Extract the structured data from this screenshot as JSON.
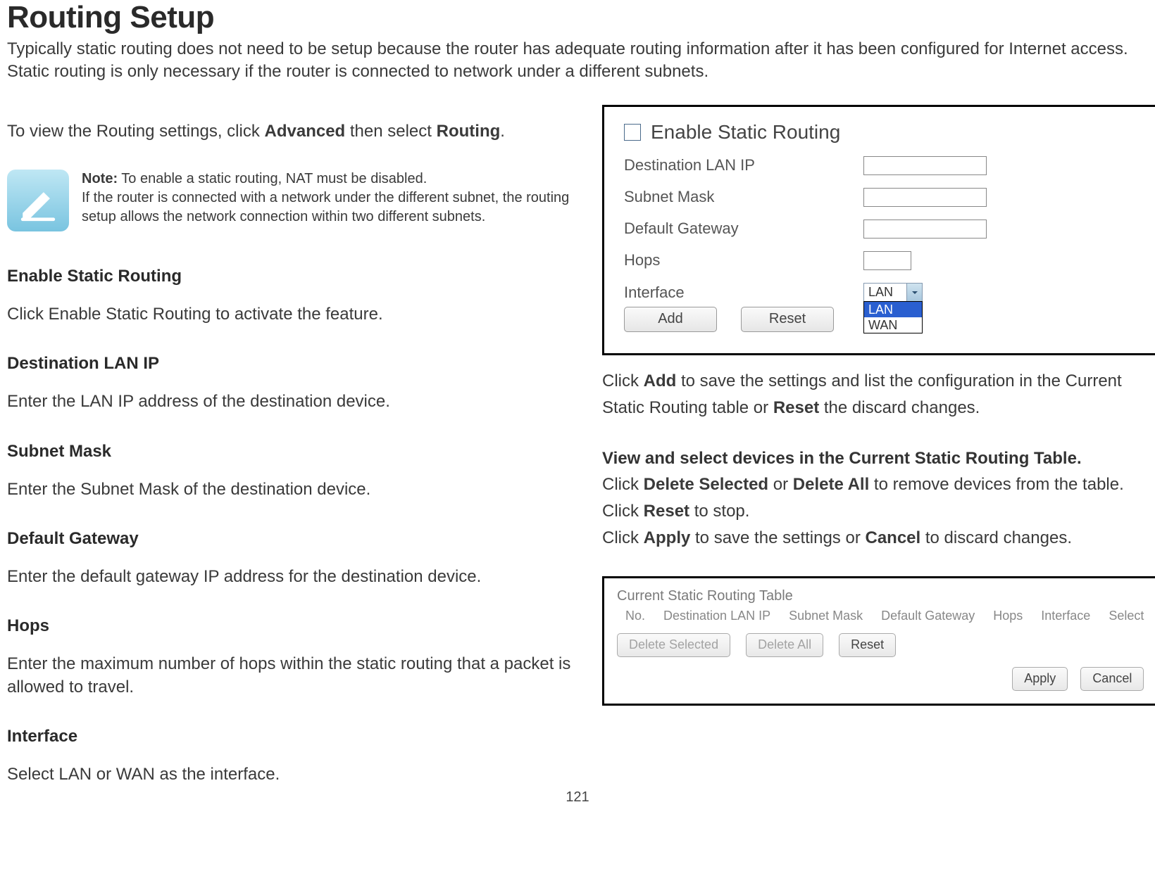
{
  "title": "Routing Setup",
  "intro": "Typically static routing does not need to be setup because the router has adequate routing information after it has been configured for Internet access. Static routing is only necessary if the router is connected to network under a different subnets.",
  "view_line_pre": "To view the Routing settings, click ",
  "view_line_b1": "Advanced",
  "view_line_mid": " then select ",
  "view_line_b2": "Routing",
  "view_line_post": ".",
  "note_label": "Note:",
  "note_line1": " To enable a static routing, NAT must be disabled.",
  "note_line2": "If the router is connected with a network under the different subnet, the routing setup allows the network connection within two different subnets.",
  "sections": {
    "enable": {
      "head": "Enable Static Routing",
      "body": "Click Enable Static Routing to activate the feature."
    },
    "dest": {
      "head": "Destination LAN IP",
      "body": "Enter the LAN IP address of the destination device."
    },
    "mask": {
      "head": "Subnet Mask",
      "body": "Enter the Subnet Mask of the destination device."
    },
    "gw": {
      "head": "Default Gateway",
      "body": "Enter the default gateway IP address for the destination device."
    },
    "hops": {
      "head": "Hops",
      "body": "Enter the maximum number of hops within the static routing that a packet is allowed to travel."
    },
    "iface": {
      "head": "Interface",
      "body": "Select LAN or WAN as the interface."
    }
  },
  "ss1": {
    "enable_label": "Enable Static Routing",
    "fields": {
      "dest": "Destination LAN IP",
      "mask": "Subnet Mask",
      "gw": "Default Gateway",
      "hops": "Hops",
      "iface": "Interface"
    },
    "iface_value": "LAN",
    "iface_options": [
      "LAN",
      "WAN"
    ],
    "btn_add": "Add",
    "btn_reset": "Reset"
  },
  "right_para1_pre": "Click ",
  "right_para1_b1": "Add",
  "right_para1_mid": " to save the settings and list the configuration in the Current Static Routing table or ",
  "right_para1_b2": "Reset",
  "right_para1_post": " the discard changes.",
  "right_head": "View and select devices in the Current Static Routing Table.",
  "right_para2_pre": "Click ",
  "right_para2_b1": "Delete Selected",
  "right_para2_mid1": " or ",
  "right_para2_b2": "Delete All",
  "right_para2_mid2": " to remove devices from the table. Click ",
  "right_para2_b3": "Reset",
  "right_para2_post": " to stop.",
  "right_para3_pre": "Click ",
  "right_para3_b1": "Apply",
  "right_para3_mid": " to save the settings or ",
  "right_para3_b2": "Cancel",
  "right_para3_post": " to discard changes.",
  "ss2": {
    "title": "Current Static Routing Table",
    "cols": [
      "No.",
      "Destination LAN IP",
      "Subnet Mask",
      "Default Gateway",
      "Hops",
      "Interface",
      "Select"
    ],
    "btn_delsel": "Delete Selected",
    "btn_delall": "Delete All",
    "btn_reset": "Reset",
    "btn_apply": "Apply",
    "btn_cancel": "Cancel"
  },
  "page_num": "121"
}
